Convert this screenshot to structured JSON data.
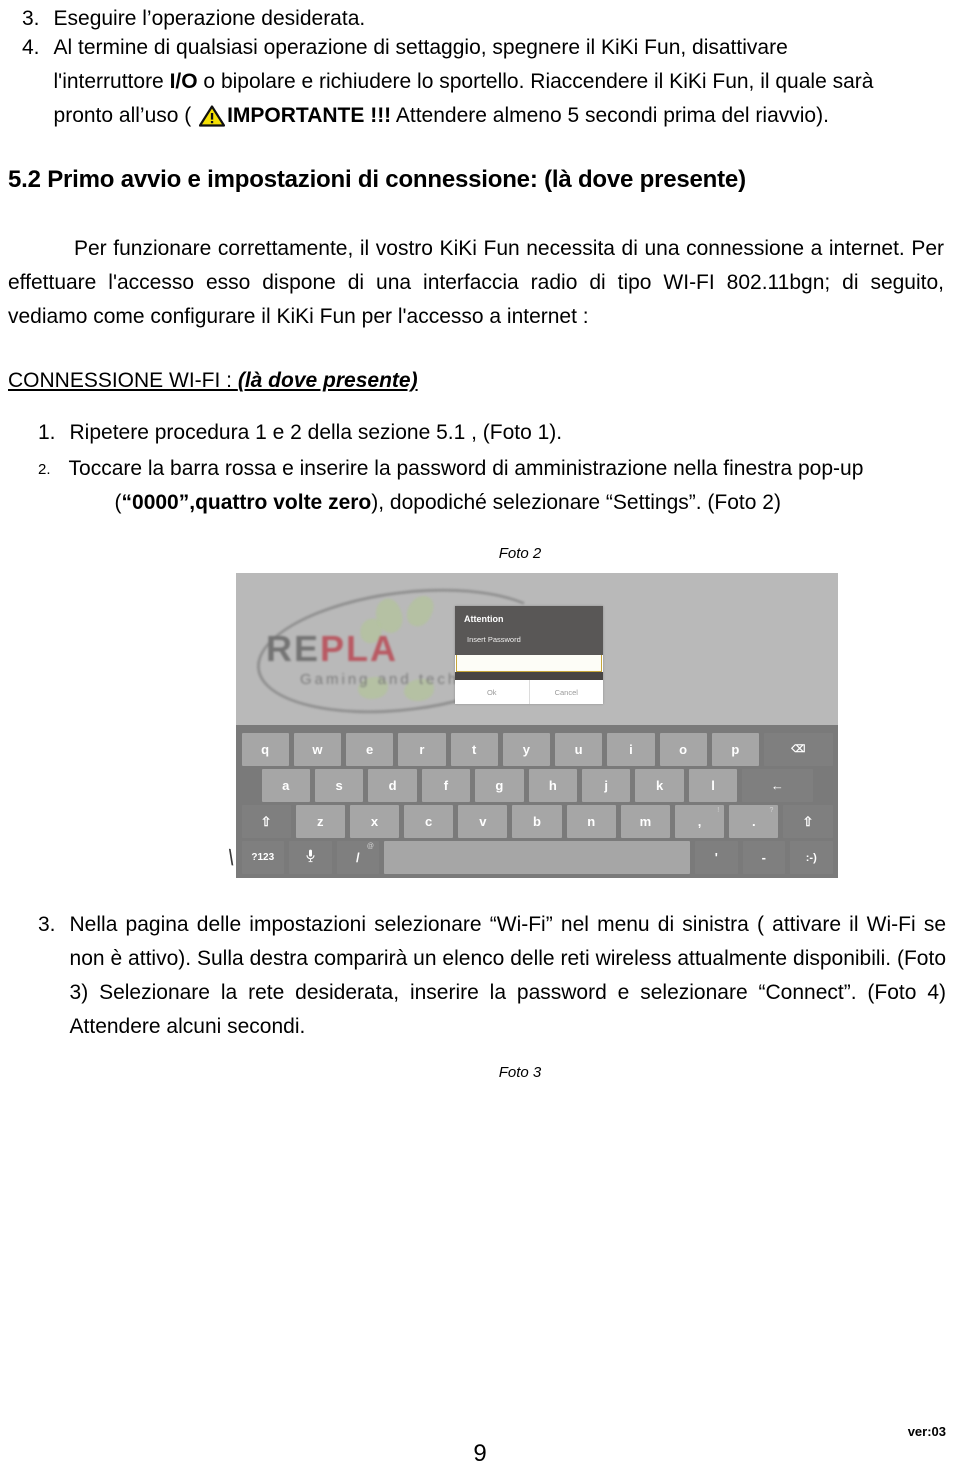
{
  "document": {
    "language": "it",
    "page_number": "9",
    "version_label": "ver:03"
  },
  "top_list": [
    {
      "marker": "3.",
      "text": "Eseguire l’operazione desiderata."
    },
    {
      "marker": "4.",
      "line1": "Al termine di qualsiasi operazione di settaggio, spegnere il KiKi Fun, disattivare",
      "line2_a": "l'interruttore ",
      "line2_b_bold": "I/O",
      "line2_c": " o bipolare e richiudere lo sportello. Riaccendere il KiKi Fun, il quale sarà",
      "line3_a": "pronto all’uso ( ",
      "line3_icon": "warning-triangle-icon",
      "line3_b_bold": "IMPORTANTE !!!",
      "line3_c": "  Attendere almeno 5 secondi prima del riavvio)."
    }
  ],
  "section": {
    "number": "5.2",
    "title": "Primo avvio e impostazioni di connessione: (là dove presente)"
  },
  "body": {
    "para1": "Per funzionare correttamente, il vostro KiKi Fun necessita di una connessione a internet. Per effettuare l'accesso esso dispone di una interfaccia radio di  tipo WI-FI 802.11bgn; di seguito, vediamo come configurare il KiKi Fun per l'accesso a internet :",
    "wifi_heading_main": "CONNESSIONE  WI-FI  : ",
    "wifi_heading_italic": "(là dove presente)"
  },
  "wifi_steps": [
    {
      "marker": "1.",
      "text": "Ripetere procedura 1 e 2  della sezione 5.1 , (Foto 1)."
    },
    {
      "marker": "2.",
      "line1": "Toccare la barra rossa e inserire la password di amministrazione nella finestra pop-up",
      "line2_a": "(",
      "line2_b_bold": "“0000”,quattro volte zero",
      "line2_c": "), dopodiché selezionare “Settings”.  (Foto 2)"
    },
    {
      "marker": "3.",
      "text": "Nella pagina delle impostazioni selezionare “Wi-Fi” nel menu di sinistra ( attivare il Wi-Fi se non è attivo). Sulla destra comparirà un elenco delle reti wireless attualmente disponibili. (Foto 3) Selezionare la rete desiderata, inserire la password e selezionare “Connect”. (Foto 4) Attendere alcuni secondi."
    }
  ],
  "captions": {
    "foto2": "Foto 2",
    "foto3": "Foto 3"
  },
  "screenshot": {
    "logo": {
      "text_r": "R",
      "text_e": "E",
      "text_pla": "PLA",
      "tagline": "Gaming and tech s"
    },
    "dialog": {
      "title": "Attention",
      "message": "Insert Password",
      "input_value": "",
      "ok_label": "Ok",
      "cancel_label": "Cancel",
      "accent_color": "#c6a63a",
      "header_color": "#595756"
    },
    "keyboard": {
      "row1": [
        "q",
        "w",
        "e",
        "r",
        "t",
        "y",
        "u",
        "i",
        "o",
        "p"
      ],
      "row1_action": "backspace-key",
      "row1_action_glyph": "⌫",
      "row2": [
        "a",
        "s",
        "d",
        "f",
        "g",
        "h",
        "j",
        "k",
        "l"
      ],
      "row2_action": "enter-key",
      "row2_action_glyph": "←",
      "row3_shift_glyph": "⇧",
      "row3": [
        "z",
        "x",
        "c",
        "v",
        "b",
        "n",
        "m"
      ],
      "row3_comma": ",",
      "row3_comma_sup": "!",
      "row3_period": ".",
      "row3_period_sup": "?",
      "row4_symbols": "?123",
      "row4_mic_glyph": "⬤",
      "row4_slash": "/",
      "row4_slash_sup": "@",
      "row4_space": "",
      "row4_apos": "'",
      "row4_dash": "-",
      "row4_emoji": ":-)"
    }
  }
}
